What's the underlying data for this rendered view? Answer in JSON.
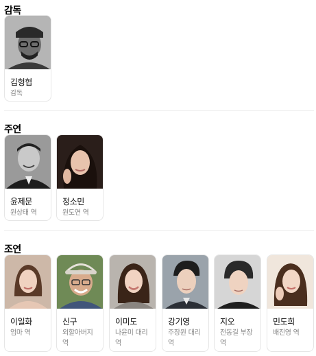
{
  "director": {
    "title": "감독",
    "people": [
      {
        "name": "김형협",
        "role": "감독",
        "icon": "director-photo"
      }
    ]
  },
  "lead": {
    "title": "주연",
    "people": [
      {
        "name": "윤제문",
        "role": "원상태 역",
        "icon": "actor-photo"
      },
      {
        "name": "정소민",
        "role": "원도연 역",
        "icon": "actor-photo"
      }
    ]
  },
  "supporting": {
    "title": "조연",
    "people": [
      {
        "name": "이일화",
        "role": "엄마 역",
        "icon": "actor-photo"
      },
      {
        "name": "신구",
        "role": "외할아버지 역",
        "icon": "actor-photo"
      },
      {
        "name": "이미도",
        "role": "나윤미 대리 역",
        "icon": "actor-photo"
      },
      {
        "name": "강기영",
        "role": "주장원 대리 역",
        "icon": "actor-photo"
      },
      {
        "name": "지오",
        "role": "전동길 부장 역",
        "icon": "actor-photo"
      },
      {
        "name": "민도희",
        "role": "배진영 역",
        "icon": "actor-photo"
      }
    ]
  }
}
